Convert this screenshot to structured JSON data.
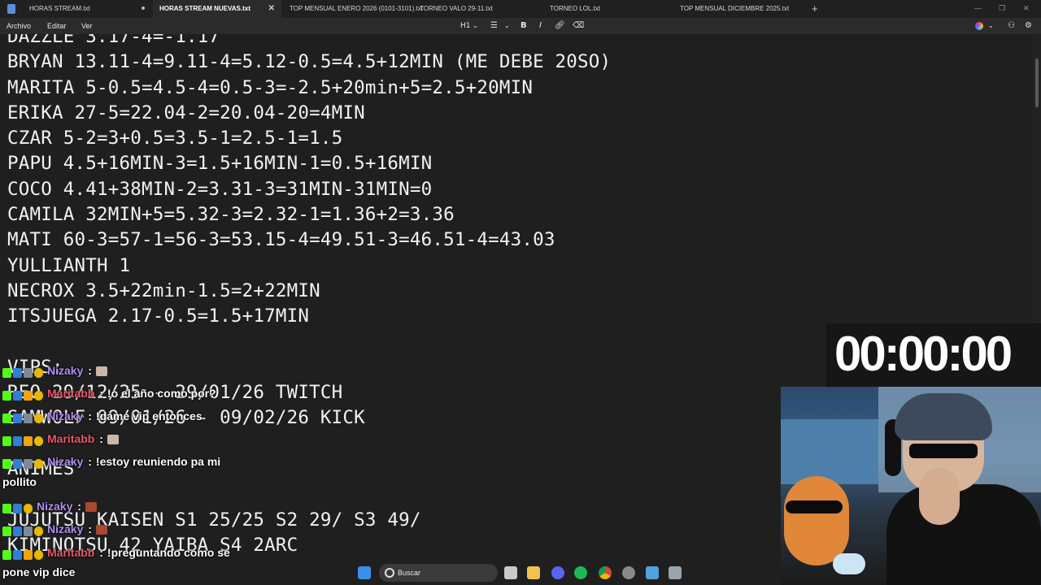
{
  "tabs": [
    {
      "label": "HORAS STREAM.txt",
      "active": false,
      "unsaved": true
    },
    {
      "label": "HORAS STREAM NUEVAS.txt",
      "active": true
    },
    {
      "label": "TOP MENSUAL ENERO 2026 (0101-3101).txt",
      "active": false
    },
    {
      "label": "TORNEO VALO 29-11.txt",
      "active": false
    },
    {
      "label": "TORNEO LOL.txt",
      "active": false
    },
    {
      "label": "TOP MENSUAL DICIEMBRE 2025.txt",
      "active": false
    }
  ],
  "new_tab_label": "+",
  "menu": {
    "archivo": "Archivo",
    "editar": "Editar",
    "ver": "Ver"
  },
  "toolbar": {
    "heading": "H1",
    "bold": "B",
    "italic": "I"
  },
  "editor_lines": [
    "DAZZLE 3.17-4=-1.17",
    "BRYAN 13.11-4=9.11-4=5.12-0.5=4.5+12MIN (ME DEBE 20SO)",
    "MARITA 5-0.5=4.5-4=0.5-3=-2.5+20min+5=2.5+20MIN",
    "ERIKA 27-5=22.04-2=20.04-20=4MIN",
    "CZAR 5-2=3+0.5=3.5-1=2.5-1=1.5",
    "PAPU 4.5+16MIN-3=1.5+16MIN-1=0.5+16MIN",
    "COCO 4.41+38MIN-2=3.31-3=31MIN-31MIN=0",
    "CAMILA 32MIN+5=5.32-3=2.32-1=1.36+2=3.36",
    "MATI 60-3=57-1=56-3=53.15-4=49.51-3=46.51-4=43.03",
    "YULLIANTH 1",
    "NECROX 3.5+22min-1.5=2+22MIN",
    "ITSJUEGA 2.17-0.5=1.5+17MIN",
    "",
    "VIPS:",
    "REO 29/12/25 - 29/01/26 TWITCH",
    "SAMWOLF 09/01/26 - 09/02/26 KICK",
    "",
    "ANIMES",
    "",
    "JUJUTSU KAISEN S1 25/25 S2 29/ S3 49/",
    "KIMINOTSU 42 YAIBA S4 2ARC"
  ],
  "timer": "00:00:00",
  "chat": [
    {
      "user": "Nizaky",
      "message": "",
      "emote": true
    },
    {
      "user": "Maritabb",
      "message": "!o el año como por?"
    },
    {
      "user": "Nizaky",
      "message": "!dame vip entonces"
    },
    {
      "user": "Maritabb",
      "message": "",
      "emote": true
    },
    {
      "user": "Nizaky",
      "message": "!estoy reuniendo pa mi",
      "continuation": "pollito"
    },
    {
      "user": "Nizaky",
      "message": "",
      "emote": true
    },
    {
      "user": "Nizaky",
      "message": "",
      "emote": true
    },
    {
      "user": "Maritabb",
      "message": "!preguntando cómo se",
      "continuation": "pone vip dice"
    }
  ],
  "chat_separator": ":",
  "taskbar": {
    "search_placeholder": "Buscar"
  },
  "colors": {
    "nizaky": "#b48cf2",
    "maritabb": "#e8586a",
    "kick_green": "#53fc18"
  }
}
